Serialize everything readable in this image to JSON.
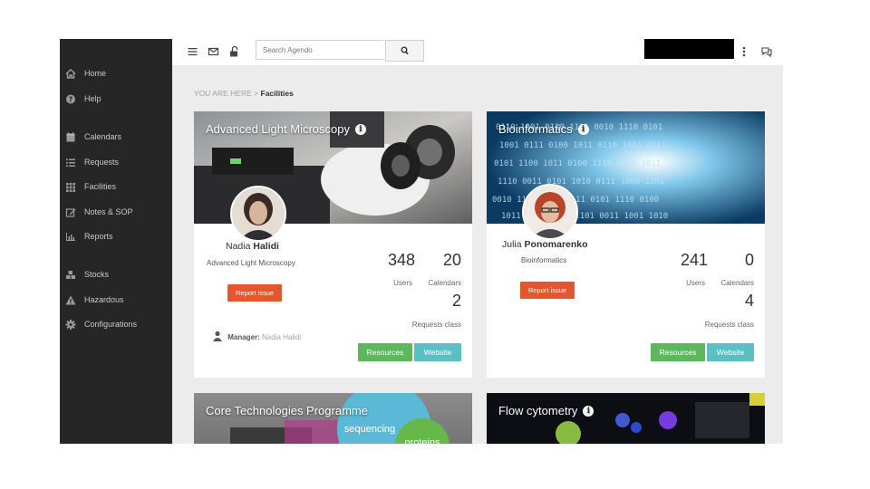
{
  "sidebar": {
    "items": [
      {
        "label": "Home",
        "icon": "home-icon"
      },
      {
        "label": "Help",
        "icon": "question-icon"
      },
      {
        "label": "Calendars",
        "icon": "calendar-icon"
      },
      {
        "label": "Requests",
        "icon": "list-icon"
      },
      {
        "label": "Facilities",
        "icon": "grid-icon"
      },
      {
        "label": "Notes & SOP",
        "icon": "edit-icon"
      },
      {
        "label": "Reports",
        "icon": "bar-chart-icon"
      },
      {
        "label": "Stocks",
        "icon": "cubes-icon"
      },
      {
        "label": "Hazardous",
        "icon": "warning-icon"
      },
      {
        "label": "Configurations",
        "icon": "gear-icon"
      }
    ]
  },
  "topbar": {
    "search_placeholder": "Search Agendo"
  },
  "breadcrumb": {
    "prefix": "YOU ARE HERE",
    "separator": ">",
    "current": "Facilities"
  },
  "cards": [
    {
      "title": "Advanced Light Microscopy",
      "person_first": "Nadia",
      "person_last": "Halidi",
      "facility": "Advanced Light Microscopy",
      "report_label": "Report issue",
      "users_count": "348",
      "users_label": "Users",
      "calendars_count": "20",
      "calendars_label": "Calendars",
      "requests_count": "2",
      "requests_label": "Requests class",
      "manager_label": "Manager:",
      "manager_name": "Nadia Halidi",
      "resources_label": "Resources",
      "website_label": "Website"
    },
    {
      "title": "Bioinformatics",
      "person_first": "Julia",
      "person_last": "Ponomarenko",
      "facility": "Bioinformatics",
      "report_label": "Report issue",
      "users_count": "241",
      "users_label": "Users",
      "calendars_count": "0",
      "calendars_label": "Calendars",
      "requests_count": "4",
      "requests_label": "Requests class",
      "resources_label": "Resources",
      "website_label": "Website"
    },
    {
      "title": "Core Technologies Programme",
      "bubbles": [
        "sequencing",
        "proteins"
      ]
    },
    {
      "title": "Flow cytometry"
    }
  ],
  "colors": {
    "sidebar_bg": "#262626",
    "report_button": "#e4572e",
    "resources_button": "#5cb85c",
    "website_button": "#5bc0c4"
  }
}
